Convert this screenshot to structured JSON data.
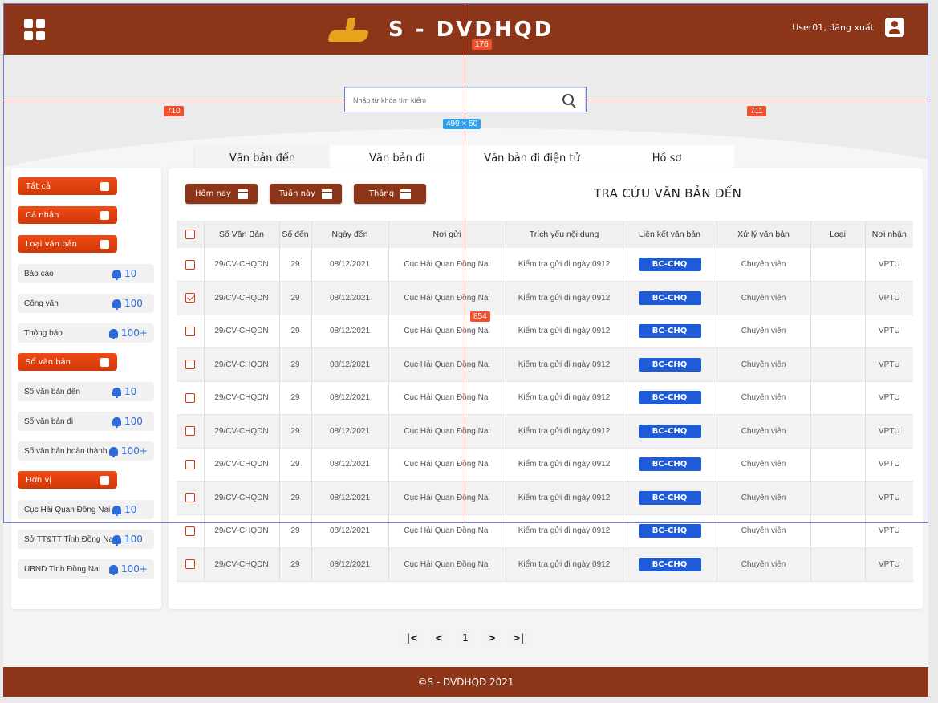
{
  "header": {
    "logo_text": "S - DVDHQD",
    "user_text": "User01, đăng xuất"
  },
  "search": {
    "placeholder": "Nhập từ khóa tìm kiếm"
  },
  "tabs": [
    {
      "label": "Văn bản đến"
    },
    {
      "label": "Văn bản đi"
    },
    {
      "label": "Văn bản đi điện tử"
    },
    {
      "label": "Hồ sơ"
    }
  ],
  "sidebar": {
    "all": "Tất cả",
    "personal": "Cá nhân",
    "doc_type": "Loại văn bản",
    "doc_type_items": [
      {
        "label": "Báo cáo",
        "count": "10"
      },
      {
        "label": "Công văn",
        "count": "100"
      },
      {
        "label": "Thông báo",
        "count": "100+"
      }
    ],
    "doc_book": "Sổ văn bản",
    "doc_book_items": [
      {
        "label": "Sổ văn bản đến",
        "count": "10"
      },
      {
        "label": "Sổ văn bản đi",
        "count": "100"
      },
      {
        "label": "Sổ văn bản hoàn thành",
        "count": "100+"
      }
    ],
    "unit": "Đơn vị",
    "unit_items": [
      {
        "label": "Cục Hải Quan Đồng Nai",
        "count": "10"
      },
      {
        "label": "Sở TT&TT Tỉnh Đồng Nai",
        "count": "100"
      },
      {
        "label": "UBND Tỉnh Đồng Nai",
        "count": "100+"
      }
    ]
  },
  "filters": {
    "today": "Hôm nay",
    "week": "Tuần này",
    "month": "Tháng"
  },
  "page_title": "TRA CỨU VĂN BẢN ĐẾN",
  "table": {
    "columns": [
      "Số Văn Bản",
      "Số đến",
      "Ngày đến",
      "Nơi gửi",
      "Trích yếu nội dung",
      "Liên kết văn bản",
      "Xử lý văn bản",
      "Loại",
      "Nơi nhận"
    ],
    "rows": [
      {
        "checked": false,
        "so_vb": "29/CV-CHQDN",
        "so_den": "29",
        "ngay_den": "08/12/2021",
        "noi_gui": "Cục Hải Quan Đồng Nai",
        "trich_yeu": "Kiểm tra gửi đi ngày 0912",
        "lien_ket": "BC-CHQ",
        "xu_ly": "Chuyên viên",
        "loai": "",
        "noi_nhan": "VPTU"
      },
      {
        "checked": true,
        "so_vb": "29/CV-CHQDN",
        "so_den": "29",
        "ngay_den": "08/12/2021",
        "noi_gui": "Cục Hải Quan Đồng Nai",
        "trich_yeu": "Kiểm tra gửi đi ngày 0912",
        "lien_ket": "BC-CHQ",
        "xu_ly": "Chuyên viên",
        "loai": "",
        "noi_nhan": "VPTU"
      },
      {
        "checked": false,
        "so_vb": "29/CV-CHQDN",
        "so_den": "29",
        "ngay_den": "08/12/2021",
        "noi_gui": "Cục Hải Quan Đồng Nai",
        "trich_yeu": "Kiểm tra gửi đi ngày 0912",
        "lien_ket": "BC-CHQ",
        "xu_ly": "Chuyên viên",
        "loai": "",
        "noi_nhan": "VPTU"
      },
      {
        "checked": false,
        "so_vb": "29/CV-CHQDN",
        "so_den": "29",
        "ngay_den": "08/12/2021",
        "noi_gui": "Cục Hải Quan Đồng Nai",
        "trich_yeu": "Kiểm tra gửi đi ngày 0912",
        "lien_ket": "BC-CHQ",
        "xu_ly": "Chuyên viên",
        "loai": "",
        "noi_nhan": "VPTU"
      },
      {
        "checked": false,
        "so_vb": "29/CV-CHQDN",
        "so_den": "29",
        "ngay_den": "08/12/2021",
        "noi_gui": "Cục Hải Quan Đồng Nai",
        "trich_yeu": "Kiểm tra gửi đi ngày 0912",
        "lien_ket": "BC-CHQ",
        "xu_ly": "Chuyên viên",
        "loai": "",
        "noi_nhan": "VPTU"
      },
      {
        "checked": false,
        "so_vb": "29/CV-CHQDN",
        "so_den": "29",
        "ngay_den": "08/12/2021",
        "noi_gui": "Cục Hải Quan Đồng Nai",
        "trich_yeu": "Kiểm tra gửi đi ngày 0912",
        "lien_ket": "BC-CHQ",
        "xu_ly": "Chuyên viên",
        "loai": "",
        "noi_nhan": "VPTU"
      },
      {
        "checked": false,
        "so_vb": "29/CV-CHQDN",
        "so_den": "29",
        "ngay_den": "08/12/2021",
        "noi_gui": "Cục Hải Quan Đồng Nai",
        "trich_yeu": "Kiểm tra gửi đi ngày 0912",
        "lien_ket": "BC-CHQ",
        "xu_ly": "Chuyên viên",
        "loai": "",
        "noi_nhan": "VPTU"
      },
      {
        "checked": false,
        "so_vb": "29/CV-CHQDN",
        "so_den": "29",
        "ngay_den": "08/12/2021",
        "noi_gui": "Cục Hải Quan Đồng Nai",
        "trich_yeu": "Kiểm tra gửi đi ngày 0912",
        "lien_ket": "BC-CHQ",
        "xu_ly": "Chuyên viên",
        "loai": "",
        "noi_nhan": "VPTU"
      },
      {
        "checked": false,
        "so_vb": "29/CV-CHQDN",
        "so_den": "29",
        "ngay_den": "08/12/2021",
        "noi_gui": "Cục Hải Quan Đồng Nai",
        "trich_yeu": "Kiểm tra gửi đi ngày 0912",
        "lien_ket": "BC-CHQ",
        "xu_ly": "Chuyên viên",
        "loai": "",
        "noi_nhan": "VPTU"
      },
      {
        "checked": false,
        "so_vb": "29/CV-CHQDN",
        "so_den": "29",
        "ngay_den": "08/12/2021",
        "noi_gui": "Cục Hải Quan Đồng Nai",
        "trich_yeu": "Kiểm tra gửi đi ngày 0912",
        "lien_ket": "BC-CHQ",
        "xu_ly": "Chuyên viên",
        "loai": "",
        "noi_nhan": "VPTU"
      }
    ]
  },
  "pagination": {
    "first": "|<",
    "prev": "<",
    "current": "1",
    "next": ">",
    "last": ">|"
  },
  "footer": {
    "text": "©S - DVDHQD 2021"
  },
  "overlays": {
    "top_gap": "176",
    "left_gap": "710",
    "right_gap": "711",
    "search_size": "499 × 50",
    "center_height": "854"
  },
  "colors": {
    "brand": "#8d3519",
    "accent": "#d23808",
    "link": "#1f5bd6"
  }
}
